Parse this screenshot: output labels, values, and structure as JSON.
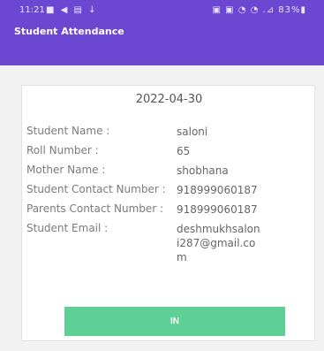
{
  "status_bar": {
    "time": "11:21",
    "left_icons": "■ ◀ ▤ ↓",
    "right_status": "▣ ▣ ◔ ◔ .⊿ 83%▮"
  },
  "app_bar": {
    "title": "Student Attendance"
  },
  "card": {
    "date": "2022-04-30",
    "fields": [
      {
        "label": "Student Name :",
        "value": "saloni"
      },
      {
        "label": "Roll Number :",
        "value": "65"
      },
      {
        "label": "Mother Name :",
        "value": "shobhana"
      },
      {
        "label": "Student Contact Number :",
        "value": "918999060187"
      },
      {
        "label": "Parents Contact Number :",
        "value": "918999060187"
      },
      {
        "label": "Student Email :",
        "value": "deshmukhsaloni287@gmail.com"
      }
    ],
    "in_button": "IN"
  },
  "colors": {
    "accent": "#6c47d1",
    "button": "#5fd095"
  }
}
